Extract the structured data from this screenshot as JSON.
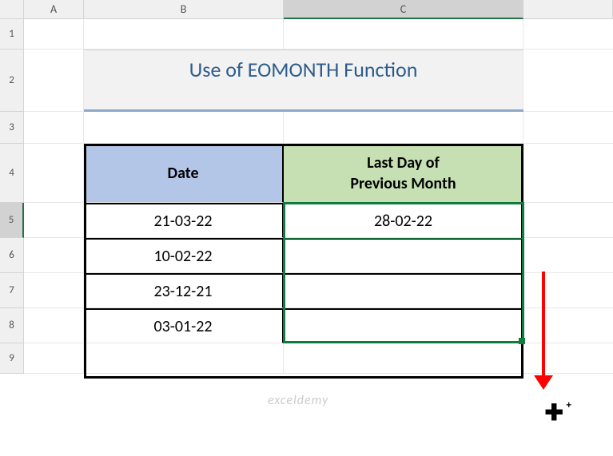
{
  "columns": [
    "A",
    "B",
    "C"
  ],
  "rows": [
    "1",
    "2",
    "3",
    "4",
    "5",
    "6",
    "7",
    "8",
    "9"
  ],
  "title": "Use of EOMONTH Function",
  "headers": {
    "date": "Date",
    "lastday_line1": "Last Day of",
    "lastday_line2": "Previous Month"
  },
  "data": {
    "b5": "21-03-22",
    "b6": "10-02-22",
    "b7": "23-12-21",
    "b8": "03-01-22",
    "c5": "28-02-22",
    "c6": "",
    "c7": "",
    "c8": ""
  },
  "watermark": "exceldemy",
  "chart_data": {
    "type": "table",
    "title": "Use of EOMONTH Function",
    "columns": [
      "Date",
      "Last Day of Previous Month"
    ],
    "rows": [
      [
        "21-03-22",
        "28-02-22"
      ],
      [
        "10-02-22",
        ""
      ],
      [
        "23-12-21",
        ""
      ],
      [
        "03-01-22",
        ""
      ]
    ]
  }
}
